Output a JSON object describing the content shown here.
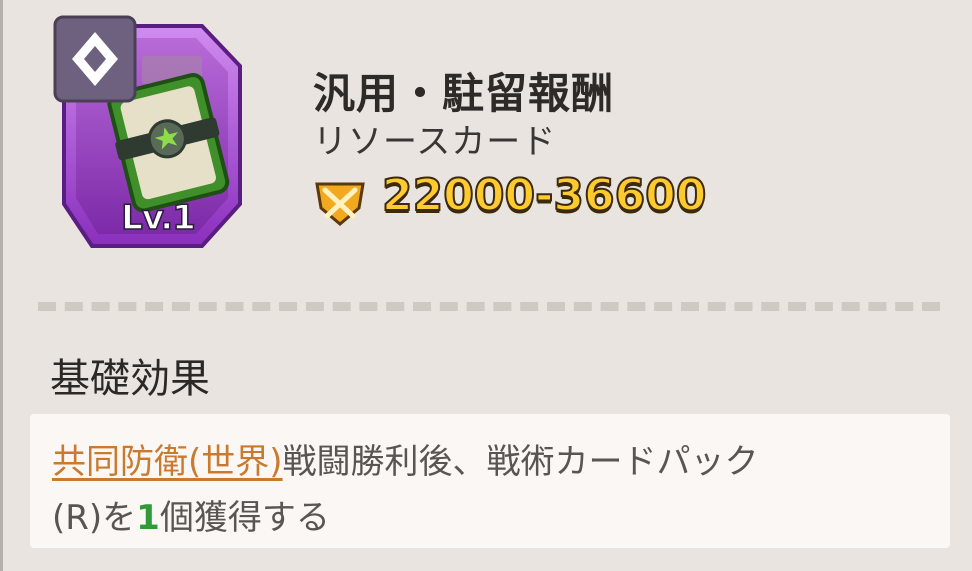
{
  "card": {
    "level": "Lv.1",
    "name": "汎用・駐留報酬",
    "type": "リソースカード",
    "trophy_range": "22000-36600",
    "rarity_icon": "diamond-badge-icon",
    "art_icon": "green-card-pack-icon",
    "trophy_icon": "crossed-swords-trophy-icon",
    "colors": {
      "frame": "#9b3fc9",
      "frame_light": "#c57be8",
      "badge": "#6e617f",
      "card_green": "#5cbf3a",
      "trophy_gold": "#ffca2e"
    }
  },
  "basic_effect": {
    "heading": "基礎効果",
    "link_text": "共同防衛(世界)",
    "line1_rest": "戦闘勝利後、戦術カードパック",
    "line2_prefix": "(R)を",
    "count": "1",
    "line2_suffix": "個獲得する"
  }
}
